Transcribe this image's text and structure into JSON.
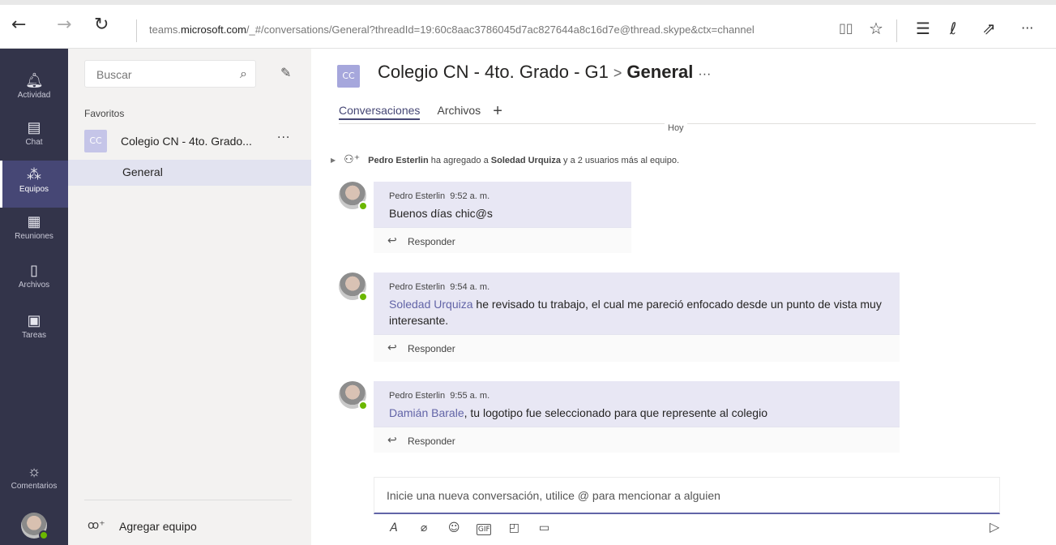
{
  "browser": {
    "back": "←",
    "forward": "→",
    "refresh": "↻",
    "url_prefix": "teams.",
    "url_domain": "microsoft.com",
    "url_path": "/_#/conversations/General?threadId=19:60c8aac3786045d7ac827644a8c16d7e@thread.skype&ctx=channel",
    "icons": [
      "reading-view-icon",
      "favorite-star-icon",
      "hub-icon",
      "notes-pen-icon",
      "share-icon",
      "more-icon"
    ]
  },
  "rail": {
    "items": [
      {
        "label": "Actividad",
        "icon": "bell-icon"
      },
      {
        "label": "Chat",
        "icon": "chat-icon"
      },
      {
        "label": "Equipos",
        "icon": "teams-icon"
      },
      {
        "label": "Reuniones",
        "icon": "calendar-icon"
      },
      {
        "label": "Archivos",
        "icon": "files-icon"
      },
      {
        "label": "Tareas",
        "icon": "tasks-icon"
      }
    ],
    "feedback": "Comentarios"
  },
  "left": {
    "search_placeholder": "Buscar",
    "favorites_label": "Favoritos",
    "team_initials": "CC",
    "team_name": "Colegio CN - 4to. Grado...",
    "team_more": "···",
    "channel": "General",
    "add_team": "Agregar equipo"
  },
  "header": {
    "initials": "CC",
    "team": "Colegio CN - 4to. Grado - G1",
    "separator": ">",
    "channel": "General",
    "more": "···"
  },
  "tabs": [
    {
      "label": "Conversaciones",
      "active": true
    },
    {
      "label": "Archivos",
      "active": false
    }
  ],
  "tab_add": "+",
  "day_label": "Hoy",
  "system_message": {
    "actor": "Pedro Esterlin",
    "text1": " ha agregado a ",
    "target": "Soledad Urquiza",
    "text2": " y a 2 usuarios más al equipo."
  },
  "messages": [
    {
      "author": "Pedro Esterlin",
      "time": "9:52 a. m.",
      "mention": "",
      "text": "Buenos días chic@s",
      "reply": "Responder"
    },
    {
      "author": "Pedro Esterlin",
      "time": "9:54 a. m.",
      "mention": "Soledad Urquiza",
      "text": " he revisado tu trabajo, el cual me pareció enfocado desde un punto de vista muy interesante.",
      "reply": "Responder"
    },
    {
      "author": "Pedro Esterlin",
      "time": "9:55 a. m.",
      "mention": "Damián Barale",
      "text": ", tu logotipo fue seleccionado para que represente al colegio",
      "reply": "Responder"
    }
  ],
  "composer": {
    "placeholder": "Inicie una nueva conversación, utilice @ para mencionar a alguien",
    "tools": [
      "format-icon",
      "attach-icon",
      "emoji-icon",
      "gif-icon",
      "sticker-icon",
      "meet-now-icon"
    ]
  },
  "colors": {
    "rail": "#33344a",
    "accent": "#6264a7",
    "presence": "#6bb700",
    "card": "#e8e7f4"
  }
}
